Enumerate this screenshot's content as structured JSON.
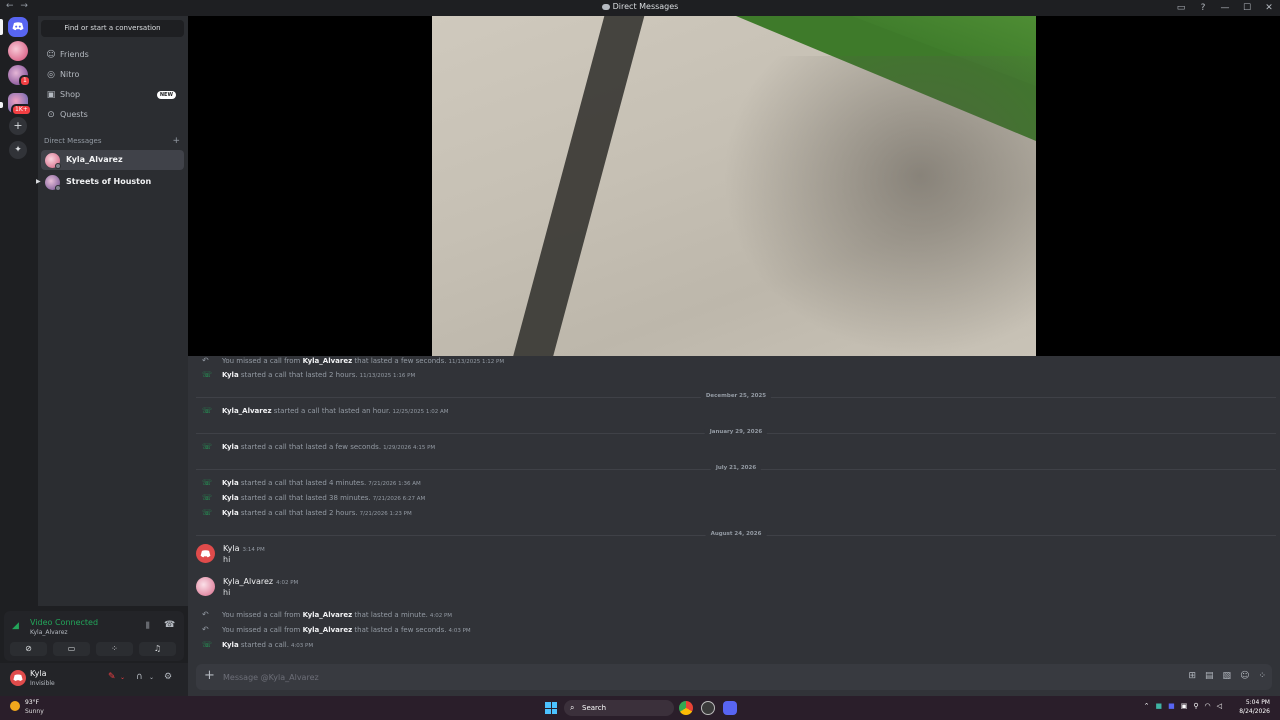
{
  "window": {
    "title": "Direct Messages",
    "back": "←",
    "forward": "→",
    "controls": [
      "▭",
      "?",
      "—",
      "☐",
      "✕"
    ]
  },
  "rail": {
    "badges": [
      "1",
      "1K+"
    ]
  },
  "sidebar": {
    "find_placeholder": "Find or start a conversation",
    "nav": [
      {
        "label": "Friends",
        "icon": "friends-icon"
      },
      {
        "label": "Nitro",
        "icon": "nitro-icon"
      },
      {
        "label": "Shop",
        "icon": "shop-icon",
        "badge": "NEW"
      },
      {
        "label": "Quests",
        "icon": "quests-icon"
      }
    ],
    "dm_header": "Direct Messages",
    "dms": [
      {
        "name": "Kyla_Alvarez"
      },
      {
        "name": "Streets of Houston"
      }
    ]
  },
  "voice": {
    "status": "Video Connected",
    "channel": "Kyla_Alvarez"
  },
  "user": {
    "name": "Kyla",
    "status": "Invisible"
  },
  "messages": {
    "sys1": {
      "pre": "You missed a call from ",
      "who": "Kyla_Alvarez",
      "post": " that lasted a few seconds.",
      "ts": "11/13/2025 1:12 PM"
    },
    "sys2": {
      "who": "Kyla",
      "post": " started a call that lasted 2 hours.",
      "ts": "11/13/2025 1:16 PM"
    },
    "div1": "December 25, 2025",
    "sys3": {
      "who": "Kyla_Alvarez",
      "post": " started a call that lasted an hour.",
      "ts": "12/25/2025 1:02 AM"
    },
    "div2": "January 29, 2026",
    "sys4": {
      "who": "Kyla",
      "post": " started a call that lasted a few seconds.",
      "ts": "1/29/2026 4:15 PM"
    },
    "div3": "July 21, 2026",
    "sys5": {
      "who": "Kyla",
      "post": " started a call that lasted 4 minutes.",
      "ts": "7/21/2026 1:36 AM"
    },
    "sys6": {
      "who": "Kyla",
      "post": " started a call that lasted 38 minutes.",
      "ts": "7/21/2026 6:27 AM"
    },
    "sys7": {
      "who": "Kyla",
      "post": " started a call that lasted 2 hours.",
      "ts": "7/21/2026 1:23 PM"
    },
    "div4": "August 24, 2026",
    "msg1": {
      "author": "Kyla",
      "ts": "3:14 PM",
      "body": "hi"
    },
    "msg2": {
      "author": "Kyla_Alvarez",
      "ts": "4:02 PM",
      "body": "hi"
    },
    "sys8": {
      "pre": "You missed a call from ",
      "who": "Kyla_Alvarez",
      "post": " that lasted a minute.",
      "ts": "4:02 PM"
    },
    "sys9": {
      "pre": "You missed a call from ",
      "who": "Kyla_Alvarez",
      "post": " that lasted a few seconds.",
      "ts": "4:03 PM"
    },
    "sys10": {
      "who": "Kyla",
      "post": " started a call.",
      "ts": "4:03 PM"
    }
  },
  "composer": {
    "placeholder": "Message @Kyla_Alvarez"
  },
  "taskbar": {
    "temp": "93°F",
    "condition": "Sunny",
    "search": "Search",
    "time": "5:04 PM",
    "date": "8/24/2026"
  },
  "colors": {
    "accent": "#5865f2",
    "connected": "#23a55a",
    "danger": "#f23f43"
  }
}
